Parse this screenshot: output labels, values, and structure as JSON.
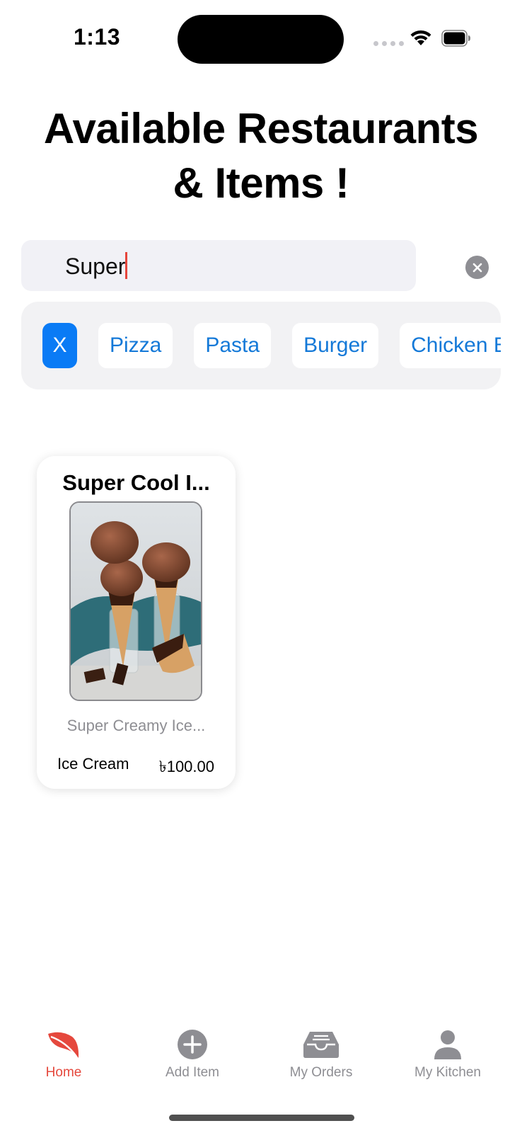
{
  "status_bar": {
    "time": "1:13"
  },
  "page": {
    "title_line1": "Available Restaurants",
    "title_line2": "& Items !"
  },
  "search": {
    "value": "Super",
    "clear_icon": "close-circle-icon"
  },
  "categories": {
    "clear_label": "X",
    "items": [
      "Pizza",
      "Pasta",
      "Burger",
      "Chicken Bir"
    ]
  },
  "results": [
    {
      "title": "Super Cool I...",
      "description": "Super Creamy Ice...",
      "category": "Ice Cream",
      "price": "৳100.00",
      "image_icon": "ice-cream-photo"
    }
  ],
  "tabbar": {
    "tabs": [
      {
        "label": "Home",
        "icon": "leaf-icon",
        "active": true
      },
      {
        "label": "Add Item",
        "icon": "plus-circle-icon",
        "active": false
      },
      {
        "label": "My Orders",
        "icon": "tray-icon",
        "active": false
      },
      {
        "label": "My Kitchen",
        "icon": "person-icon",
        "active": false
      }
    ]
  },
  "colors": {
    "accent": "#e5483d",
    "chip_text": "#1479d8",
    "chip_selected": "#0a7bf5",
    "inactive": "#8e8e93"
  }
}
